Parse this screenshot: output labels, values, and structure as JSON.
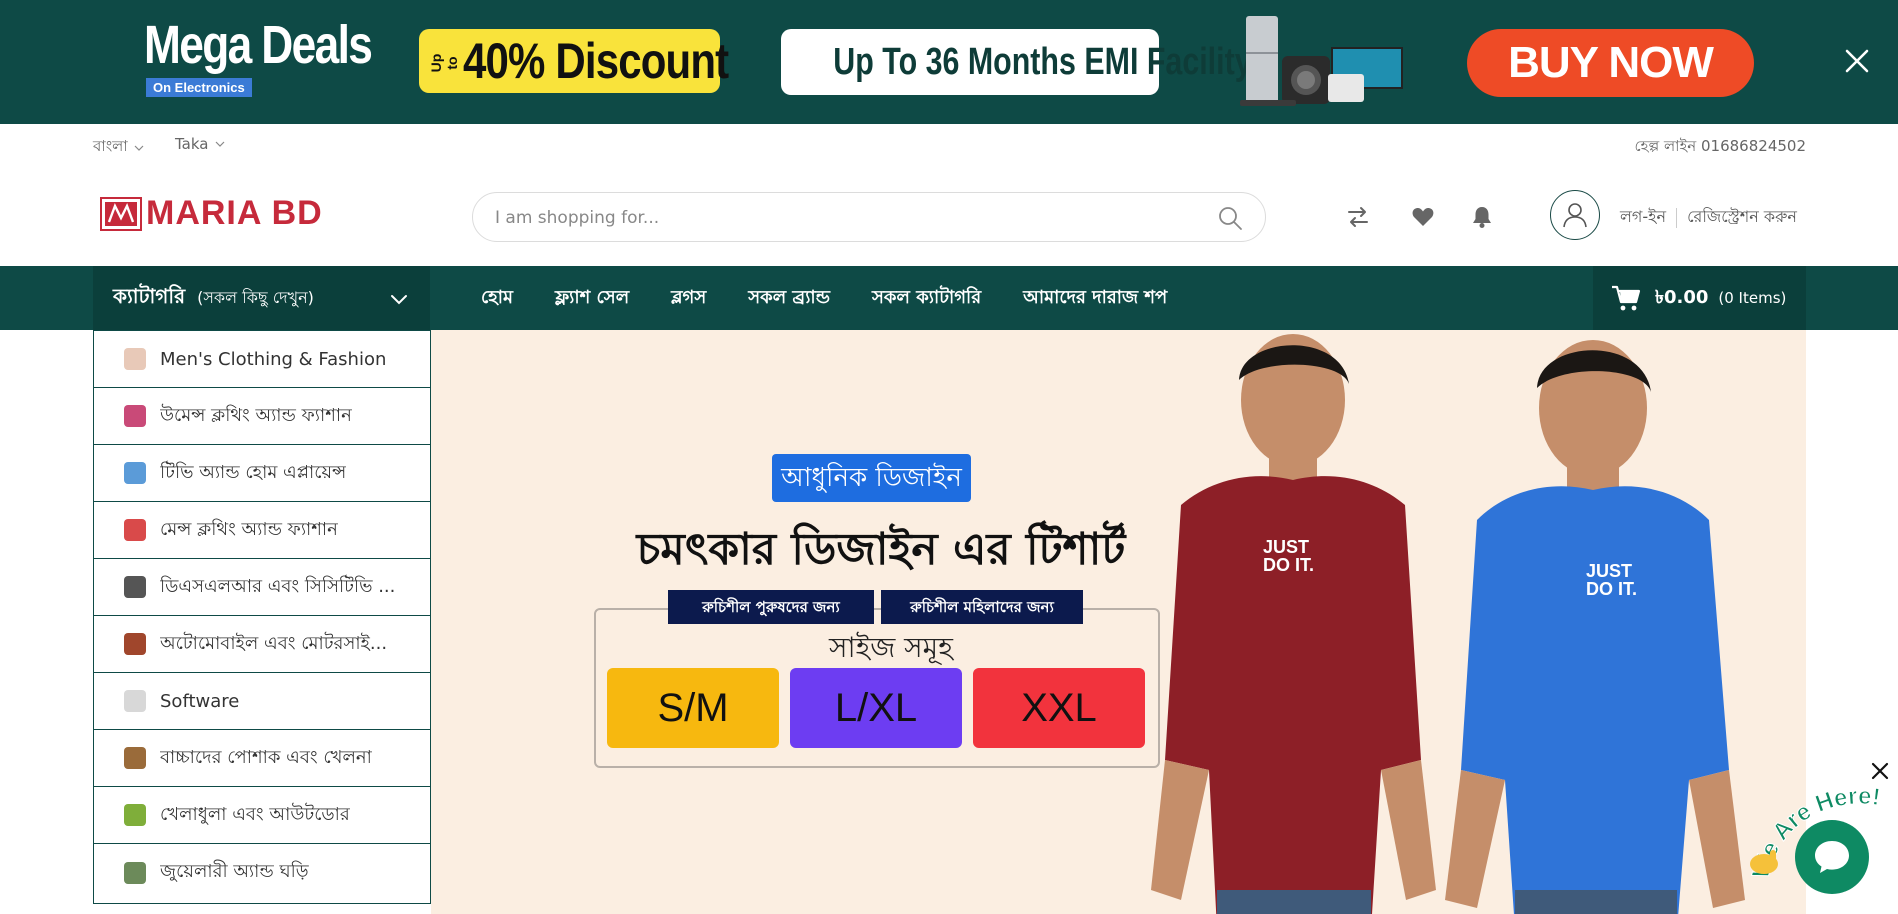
{
  "promo": {
    "title": "Mega Deals",
    "subtitle": "On Electronics",
    "discount_prefix": "Up to",
    "discount": "40% Discount",
    "emi": "Up To 36 Months EMI Facility",
    "cta": "BUY NOW"
  },
  "topbar": {
    "language": "বাংলা",
    "currency": "Taka",
    "helpline": "হেল্প লাইন 01686824502"
  },
  "header": {
    "logo_text": "MARIA BD",
    "search_placeholder": "I am shopping for...",
    "login": "লগ-ইন",
    "register": "রেজিস্ট্রেশন করুন"
  },
  "nav": {
    "category_title": "ক্যাটাগরি",
    "category_sub": "(সকল কিছু দেখুন)",
    "links": [
      "হোম",
      "ফ্ল্যাশ সেল",
      "ব্লগস",
      "সকল ব্র্যান্ড",
      "সকল ক্যাটাগরি",
      "আমাদের দারাজ শপ"
    ],
    "cart_amount": "৳0.00",
    "cart_items": "(0 Items)"
  },
  "categories": [
    {
      "label": "Men's Clothing & Fashion",
      "icon": "clothing-icon",
      "color": "#e8c9b8"
    },
    {
      "label": "উমেন্স ক্লথিং অ্যান্ড ফ্যাশান",
      "icon": "womens-clothing-icon",
      "color": "#c94a78"
    },
    {
      "label": "টিভি অ্যান্ড হোম এপ্লায়েন্স",
      "icon": "tv-icon",
      "color": "#5b9bd8"
    },
    {
      "label": "মেন্স ক্লথিং অ্যান্ড ফ্যাশান",
      "icon": "dress-icon",
      "color": "#d94a4a"
    },
    {
      "label": "ডিএসএলআর এবং সিসিটিভি ...",
      "icon": "camera-icon",
      "color": "#555555"
    },
    {
      "label": "অটোমোবাইল এবং মোটরসাই...",
      "icon": "motorbike-icon",
      "color": "#a0462c"
    },
    {
      "label": "Software",
      "icon": "software-icon",
      "color": "#d8d8d8"
    },
    {
      "label": "বাচ্চাদের পোশাক এবং খেলনা",
      "icon": "toy-icon",
      "color": "#9a6b3a"
    },
    {
      "label": "খেলাধুলা এবং আউটডোর",
      "icon": "sports-icon",
      "color": "#7fae3a"
    },
    {
      "label": "জুয়েলারী অ্যান্ড ঘড়ি",
      "icon": "jewelry-icon",
      "color": "#6c8a5a"
    }
  ],
  "hero": {
    "tag": "আধুনিক ডিজাইন",
    "headline": "চমৎকার ডিজাইন এর টিশার্ট",
    "sub_left": "রুচিশীল পুরুষদের জন্য",
    "sub_right": "রুচিশীল মহিলাদের জন্য",
    "size_title": "সাইজ সমূহ",
    "sizes": [
      {
        "label": "S/M",
        "color": "#f7b80f"
      },
      {
        "label": "L/XL",
        "color": "#6d3df2"
      },
      {
        "label": "XXL",
        "color": "#f2333d"
      }
    ],
    "shirt_text": "JUST DO IT.",
    "shirt_colors": [
      "#8d1f27",
      "#2f74d8"
    ]
  },
  "chat": {
    "bubble_text": "We Are Here!"
  },
  "colors": {
    "brand_dark": "#0e4a46",
    "brand_red": "#c62a3b"
  }
}
